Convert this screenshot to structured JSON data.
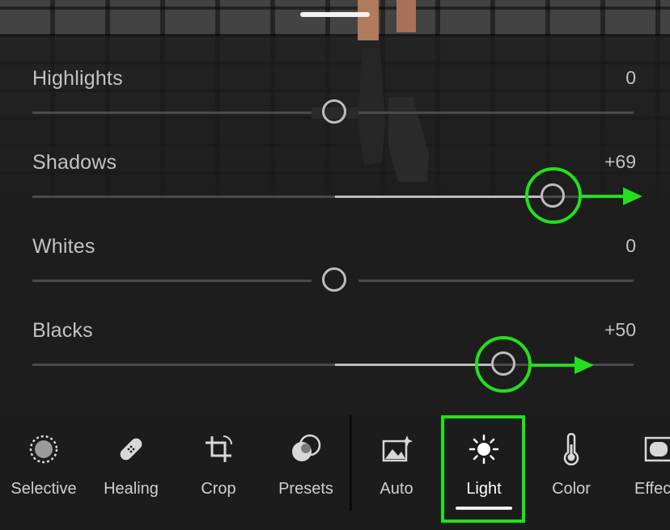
{
  "sliders": [
    {
      "label": "Highlights",
      "value": "0",
      "level": 0
    },
    {
      "label": "Shadows",
      "value": "+69",
      "level": 69
    },
    {
      "label": "Whites",
      "value": "0",
      "level": 0
    },
    {
      "label": "Blacks",
      "value": "+50",
      "level": 50
    }
  ],
  "toolbar": {
    "items": [
      {
        "label": "Selective",
        "icon": "selective-icon"
      },
      {
        "label": "Healing",
        "icon": "bandage-icon"
      },
      {
        "label": "Crop",
        "icon": "crop-icon"
      },
      {
        "label": "Presets",
        "icon": "presets-icon"
      },
      {
        "label": "Auto",
        "icon": "auto-image-icon"
      },
      {
        "label": "Light",
        "icon": "sun-icon",
        "active": true
      },
      {
        "label": "Color",
        "icon": "thermometer-icon"
      },
      {
        "label": "Effects",
        "icon": "effects-icon"
      }
    ]
  },
  "colors": {
    "annotation": "#22e01c",
    "accent": "#f0f0f0",
    "background": "#1c1c1c"
  }
}
